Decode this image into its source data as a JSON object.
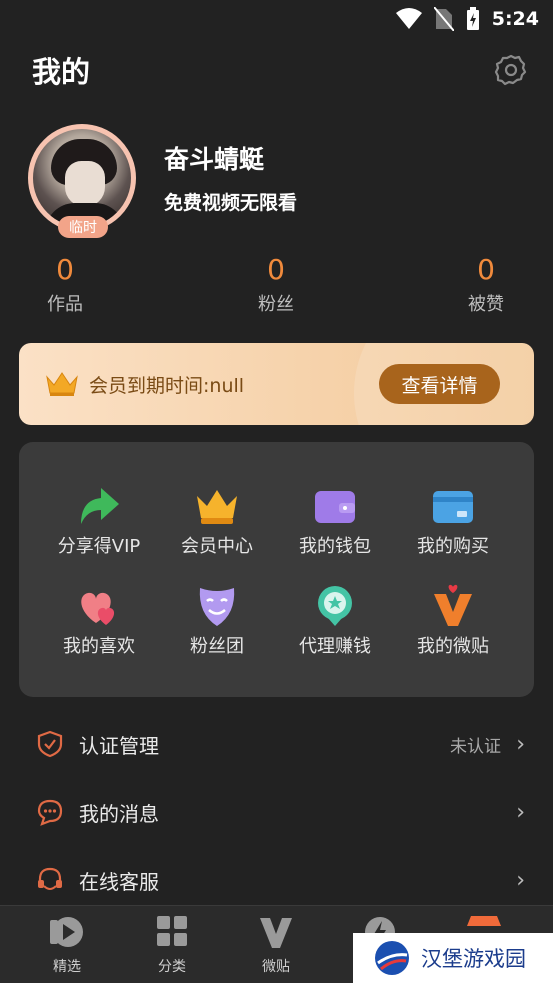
{
  "status_bar": {
    "time": "5:24"
  },
  "header": {
    "title": "我的"
  },
  "profile": {
    "username": "奋斗蜻蜓",
    "subtitle": "免费视频无限看",
    "avatar_badge": "临时"
  },
  "stats": [
    {
      "value": "0",
      "label": "作品"
    },
    {
      "value": "0",
      "label": "粉丝"
    },
    {
      "value": "0",
      "label": "被赞"
    }
  ],
  "vip": {
    "expiry_text": "会员到期时间:null",
    "detail_button": "查看详情"
  },
  "features": [
    {
      "label": "分享得VIP",
      "icon": "share-arrow-icon"
    },
    {
      "label": "会员中心",
      "icon": "crown-icon"
    },
    {
      "label": "我的钱包",
      "icon": "wallet-icon"
    },
    {
      "label": "我的购买",
      "icon": "card-icon"
    },
    {
      "label": "我的喜欢",
      "icon": "hearts-icon"
    },
    {
      "label": "粉丝团",
      "icon": "mask-icon"
    },
    {
      "label": "代理赚钱",
      "icon": "star-badge-icon"
    },
    {
      "label": "我的微贴",
      "icon": "v-heart-icon"
    }
  ],
  "menu": [
    {
      "label": "认证管理",
      "right_text": "未认证",
      "icon": "shield-check-icon"
    },
    {
      "label": "我的消息",
      "right_text": "",
      "icon": "message-bubble-icon"
    },
    {
      "label": "在线客服",
      "right_text": "",
      "icon": "headset-icon"
    }
  ],
  "tabbar": [
    {
      "label": "精选",
      "icon": "play-icon"
    },
    {
      "label": "分类",
      "icon": "grid-icon"
    },
    {
      "label": "微贴",
      "icon": "v-icon"
    }
  ],
  "watermark": {
    "text": "汉堡游戏园"
  },
  "colors": {
    "background": "#222222",
    "accent_orange": "#f08a3c",
    "vip_button": "#a8641c",
    "card_bg": "#3b3b3b"
  }
}
